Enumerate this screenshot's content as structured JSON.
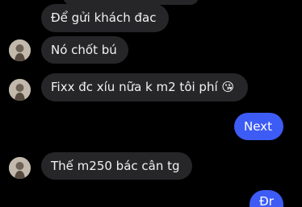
{
  "messages": [
    {
      "text": "Để gửi khách đac",
      "direction": "incoming"
    },
    {
      "text": "Nó chốt bú",
      "direction": "incoming"
    },
    {
      "text": "Fixx đc xíu nữa k m2 tôi phí",
      "emoji": "😘",
      "direction": "incoming"
    },
    {
      "text": "Next",
      "direction": "outgoing"
    },
    {
      "text": "Thế m250 bác cân tg",
      "direction": "incoming"
    },
    {
      "text": "Đr",
      "direction": "outgoing"
    }
  ],
  "colors": {
    "background": "#000000",
    "incoming_bubble": "#262629",
    "outgoing_bubble": "#3d5cf5",
    "text": "#f2f2f2"
  },
  "icons": [
    "avatar",
    "kissing-face-emoji"
  ]
}
